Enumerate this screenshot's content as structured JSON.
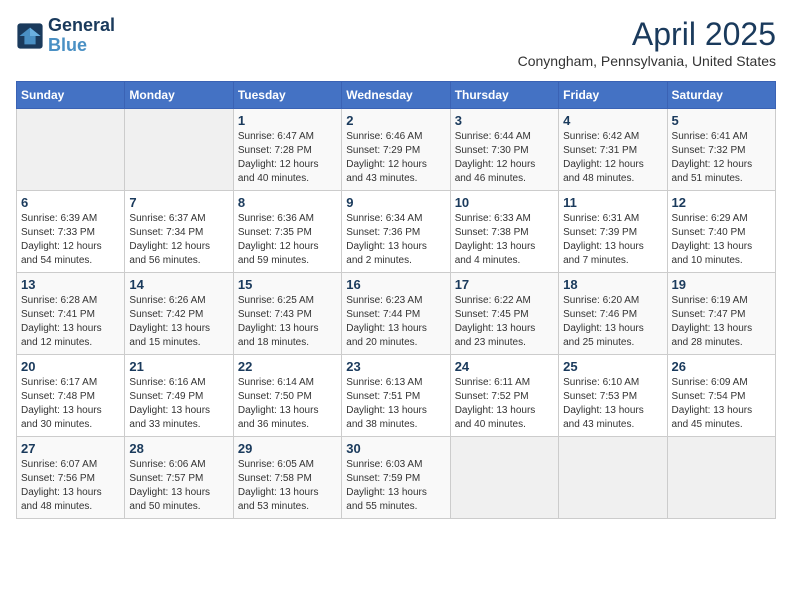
{
  "logo": {
    "line1": "General",
    "line2": "Blue"
  },
  "title": "April 2025",
  "subtitle": "Conyngham, Pennsylvania, United States",
  "days_of_week": [
    "Sunday",
    "Monday",
    "Tuesday",
    "Wednesday",
    "Thursday",
    "Friday",
    "Saturday"
  ],
  "weeks": [
    [
      {
        "day": "",
        "info": ""
      },
      {
        "day": "",
        "info": ""
      },
      {
        "day": "1",
        "info": "Sunrise: 6:47 AM\nSunset: 7:28 PM\nDaylight: 12 hours\nand 40 minutes."
      },
      {
        "day": "2",
        "info": "Sunrise: 6:46 AM\nSunset: 7:29 PM\nDaylight: 12 hours\nand 43 minutes."
      },
      {
        "day": "3",
        "info": "Sunrise: 6:44 AM\nSunset: 7:30 PM\nDaylight: 12 hours\nand 46 minutes."
      },
      {
        "day": "4",
        "info": "Sunrise: 6:42 AM\nSunset: 7:31 PM\nDaylight: 12 hours\nand 48 minutes."
      },
      {
        "day": "5",
        "info": "Sunrise: 6:41 AM\nSunset: 7:32 PM\nDaylight: 12 hours\nand 51 minutes."
      }
    ],
    [
      {
        "day": "6",
        "info": "Sunrise: 6:39 AM\nSunset: 7:33 PM\nDaylight: 12 hours\nand 54 minutes."
      },
      {
        "day": "7",
        "info": "Sunrise: 6:37 AM\nSunset: 7:34 PM\nDaylight: 12 hours\nand 56 minutes."
      },
      {
        "day": "8",
        "info": "Sunrise: 6:36 AM\nSunset: 7:35 PM\nDaylight: 12 hours\nand 59 minutes."
      },
      {
        "day": "9",
        "info": "Sunrise: 6:34 AM\nSunset: 7:36 PM\nDaylight: 13 hours\nand 2 minutes."
      },
      {
        "day": "10",
        "info": "Sunrise: 6:33 AM\nSunset: 7:38 PM\nDaylight: 13 hours\nand 4 minutes."
      },
      {
        "day": "11",
        "info": "Sunrise: 6:31 AM\nSunset: 7:39 PM\nDaylight: 13 hours\nand 7 minutes."
      },
      {
        "day": "12",
        "info": "Sunrise: 6:29 AM\nSunset: 7:40 PM\nDaylight: 13 hours\nand 10 minutes."
      }
    ],
    [
      {
        "day": "13",
        "info": "Sunrise: 6:28 AM\nSunset: 7:41 PM\nDaylight: 13 hours\nand 12 minutes."
      },
      {
        "day": "14",
        "info": "Sunrise: 6:26 AM\nSunset: 7:42 PM\nDaylight: 13 hours\nand 15 minutes."
      },
      {
        "day": "15",
        "info": "Sunrise: 6:25 AM\nSunset: 7:43 PM\nDaylight: 13 hours\nand 18 minutes."
      },
      {
        "day": "16",
        "info": "Sunrise: 6:23 AM\nSunset: 7:44 PM\nDaylight: 13 hours\nand 20 minutes."
      },
      {
        "day": "17",
        "info": "Sunrise: 6:22 AM\nSunset: 7:45 PM\nDaylight: 13 hours\nand 23 minutes."
      },
      {
        "day": "18",
        "info": "Sunrise: 6:20 AM\nSunset: 7:46 PM\nDaylight: 13 hours\nand 25 minutes."
      },
      {
        "day": "19",
        "info": "Sunrise: 6:19 AM\nSunset: 7:47 PM\nDaylight: 13 hours\nand 28 minutes."
      }
    ],
    [
      {
        "day": "20",
        "info": "Sunrise: 6:17 AM\nSunset: 7:48 PM\nDaylight: 13 hours\nand 30 minutes."
      },
      {
        "day": "21",
        "info": "Sunrise: 6:16 AM\nSunset: 7:49 PM\nDaylight: 13 hours\nand 33 minutes."
      },
      {
        "day": "22",
        "info": "Sunrise: 6:14 AM\nSunset: 7:50 PM\nDaylight: 13 hours\nand 36 minutes."
      },
      {
        "day": "23",
        "info": "Sunrise: 6:13 AM\nSunset: 7:51 PM\nDaylight: 13 hours\nand 38 minutes."
      },
      {
        "day": "24",
        "info": "Sunrise: 6:11 AM\nSunset: 7:52 PM\nDaylight: 13 hours\nand 40 minutes."
      },
      {
        "day": "25",
        "info": "Sunrise: 6:10 AM\nSunset: 7:53 PM\nDaylight: 13 hours\nand 43 minutes."
      },
      {
        "day": "26",
        "info": "Sunrise: 6:09 AM\nSunset: 7:54 PM\nDaylight: 13 hours\nand 45 minutes."
      }
    ],
    [
      {
        "day": "27",
        "info": "Sunrise: 6:07 AM\nSunset: 7:56 PM\nDaylight: 13 hours\nand 48 minutes."
      },
      {
        "day": "28",
        "info": "Sunrise: 6:06 AM\nSunset: 7:57 PM\nDaylight: 13 hours\nand 50 minutes."
      },
      {
        "day": "29",
        "info": "Sunrise: 6:05 AM\nSunset: 7:58 PM\nDaylight: 13 hours\nand 53 minutes."
      },
      {
        "day": "30",
        "info": "Sunrise: 6:03 AM\nSunset: 7:59 PM\nDaylight: 13 hours\nand 55 minutes."
      },
      {
        "day": "",
        "info": ""
      },
      {
        "day": "",
        "info": ""
      },
      {
        "day": "",
        "info": ""
      }
    ]
  ]
}
